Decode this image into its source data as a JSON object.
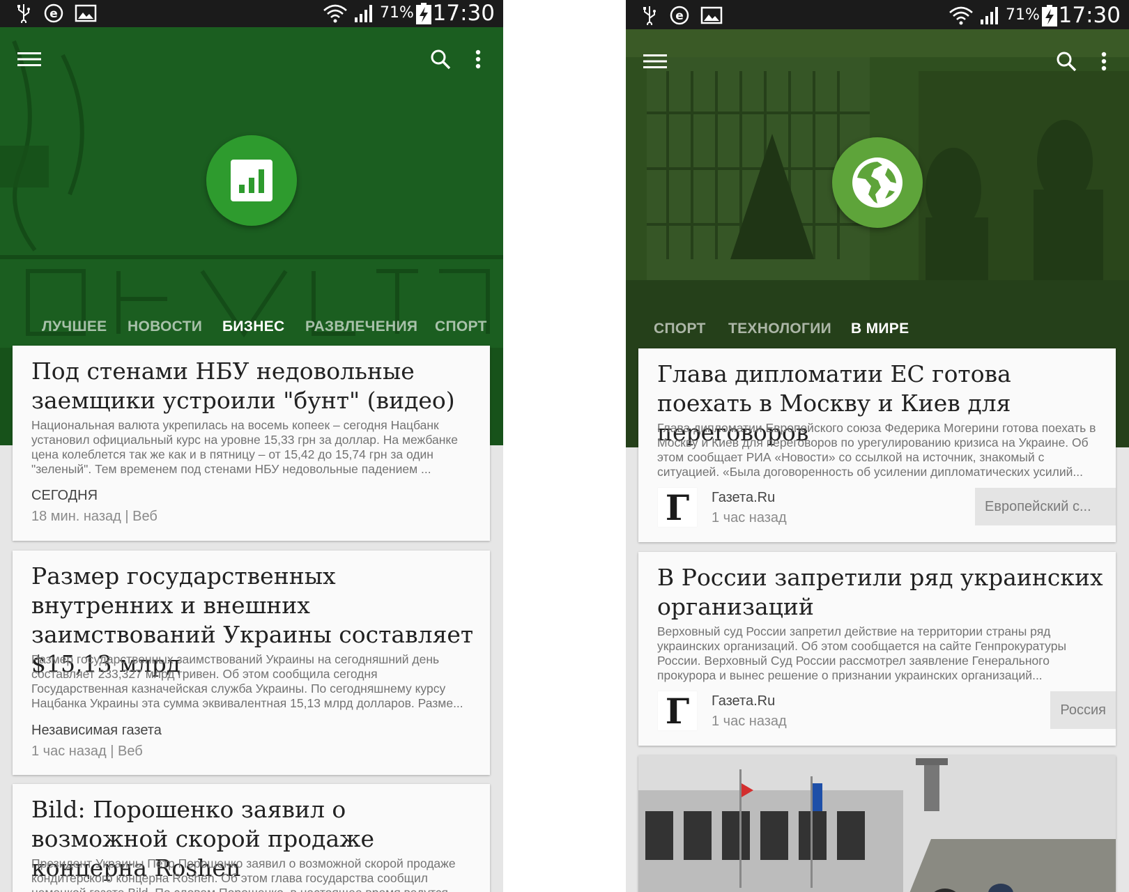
{
  "status_bar": {
    "battery": "71%",
    "time": "17:30"
  },
  "colors": {
    "primary_dark": "#1b5e20",
    "accent_left": "#2e9b2e",
    "accent_right": "#5ea43a"
  },
  "left": {
    "fab_icon": "bar-chart-icon",
    "tabs": [
      "ЛУЧШЕЕ",
      "НОВОСТИ",
      "БИЗНЕС",
      "РАЗВЛЕЧЕНИЯ",
      "СПОРТ"
    ],
    "active_tab": "БИЗНЕС",
    "cards": [
      {
        "title": "Под стенами НБУ недовольные заемщики устроили \"бунт\" (видео)",
        "snippet": "Национальная валюта укрепилась на восемь копеек – сегодня Нацбанк установил официальный курс на уровне 15,33 грн за доллар. На межбанке цена колеблется так же как и в пятницу – от 15,42 до 15,74 грн за один \"зеленый\". Тем временем под стенами НБУ недовольные падением ...",
        "source": "СЕГОДНЯ",
        "time": "18 мин. назад | Веб"
      },
      {
        "title": "Размер государственных внутренних и внешних заимствований Украины составляет $15,13 млрд",
        "snippet": "Размер государственных заимствований Украины на сегодняшний день составляет 233,327 млрд гривен. Об этом сообщила сегодня Государственная казначейская служба Украины. По сегодняшнему курсу Нацбанка Украины эта сумма эквивалентная 15,13 млрд долларов. Разме...",
        "source": "Независимая газета",
        "time": "1 час назад | Веб"
      },
      {
        "title": "Bild: Порошенко заявил о возможной скорой продаже концерна Roshen",
        "snippet": "Президент Украины Петр Порошенко заявил о возможной скорой продаже кондитерского концерна Roshen. Об этом глава государства сообщил немецкой газете Bild. По словам Порошенко, в настоящее время ведутся",
        "source": "",
        "time": ""
      }
    ]
  },
  "right": {
    "fab_icon": "globe-icon",
    "tabs": [
      "СПОРТ",
      "ТЕХНОЛОГИИ",
      "В МИРЕ"
    ],
    "active_tab": "В МИРЕ",
    "cards": [
      {
        "title": "Глава дипломатии ЕС готова поехать в Москву и Киев для переговоров",
        "snippet": "Глава дипломатии Европейского союза Федерика Могерини готова поехать в Москву и Киев для переговоров по урегулированию кризиса на Украине. Об этом сообщает РИА «Новости» со ссылкой на источник, знакомый с ситуацией. «Была договоренность об усилении дипломатических усилий...",
        "logo": "Г",
        "source": "Газета.Ru",
        "time": "1 час назад",
        "topic": "Европейский с..."
      },
      {
        "title": "В России запретили ряд украинских организаций",
        "snippet": "Верховный суд России запретил действие на территории страны ряд украинских организаций. Об этом сообщается на сайте Генпрокуратуры России. Верховный Суд России рассмотрел заявление Генерального прокурора и вынес решение о признании украинских организаций...",
        "logo": "Г",
        "source": "Газета.Ru",
        "time": "1 час назад",
        "topic": "Россия"
      }
    ]
  }
}
